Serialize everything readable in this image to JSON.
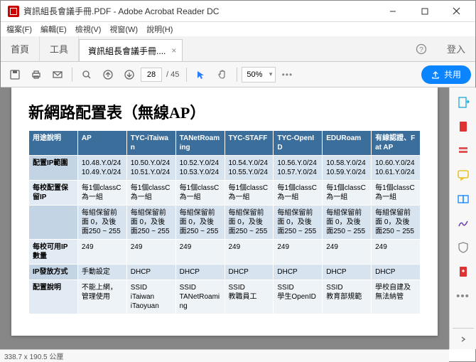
{
  "window": {
    "title": "資訊組長會議手冊.PDF - Adobe Acrobat Reader DC"
  },
  "menu": {
    "file": "檔案(F)",
    "edit": "編輯(E)",
    "view": "檢視(V)",
    "window": "視窗(W)",
    "help": "說明(H)"
  },
  "tabs": {
    "home": "首頁",
    "tools": "工具",
    "doc": "資訊組長會議手冊....",
    "login": "登入"
  },
  "toolbar": {
    "page": "28",
    "pages": "/ 45",
    "zoom": "50%",
    "share": "共用"
  },
  "doc": {
    "title": "新網路配置表（無線AP）",
    "headers": [
      "用途說明",
      "AP",
      "TYC-iTaiwan",
      "TANetRoaming",
      "TYC-STAFF",
      "TYC-OpenID",
      "EDURoam",
      "有線認證、Fat AP"
    ],
    "rows": [
      {
        "h": "配置IP範圍",
        "c": [
          "10.48.Y.0/24\n10.49.Y.0/24",
          "10.50.Y.0/24\n10.51.Y.0/24",
          "10.52.Y.0/24\n10.53.Y.0/24",
          "10.54.Y.0/24\n10.55.Y.0/24",
          "10.56.Y.0/24\n10.57.Y.0/24",
          "10.58.Y.0/24\n10.59.Y.0/24",
          "10.60.Y.0/24\n10.61.Y.0/24"
        ]
      },
      {
        "h": "每校配置保留IP",
        "c": [
          "每1個classC 為一組",
          "每1個classC 為一組",
          "每1個classC 為一組",
          "每1個classC 為一組",
          "每1個classC 為一組",
          "每1個classC 為一組",
          "每1個classC 為一組"
        ]
      },
      {
        "h": "",
        "c": [
          "每組保留前面 0，及後面250 ~ 255",
          "每組保留前面 0，及後面250 ~ 255",
          "每組保留前面 0，及後面250 ~ 255",
          "每組保留前面 0，及後面250 ~ 255",
          "每組保留前面 0，及後面250 ~ 255",
          "每組保留前面 0，及後面250 ~ 255",
          "每組保留前面 0，及後面250 ~ 255"
        ]
      },
      {
        "h": "每校可用IP數量",
        "c": [
          "249",
          "249",
          "249",
          "249",
          "249",
          "249",
          "249"
        ]
      },
      {
        "h": "IP發放方式",
        "c": [
          "手動設定",
          "DHCP",
          "DHCP",
          "DHCP",
          "DHCP",
          "DHCP",
          "DHCP"
        ]
      },
      {
        "h": "配置說明",
        "c": [
          "不能上網，管理使用",
          "SSID\niTaiwan\niTaoyuan",
          "SSID\nTANetRoaming",
          "SSID\n教職員工",
          "SSID\n學生OpenID",
          "SSID\n教育部規範",
          "學校自建及無法納管"
        ]
      }
    ]
  },
  "status": "338.7 x 190.5 公厘"
}
